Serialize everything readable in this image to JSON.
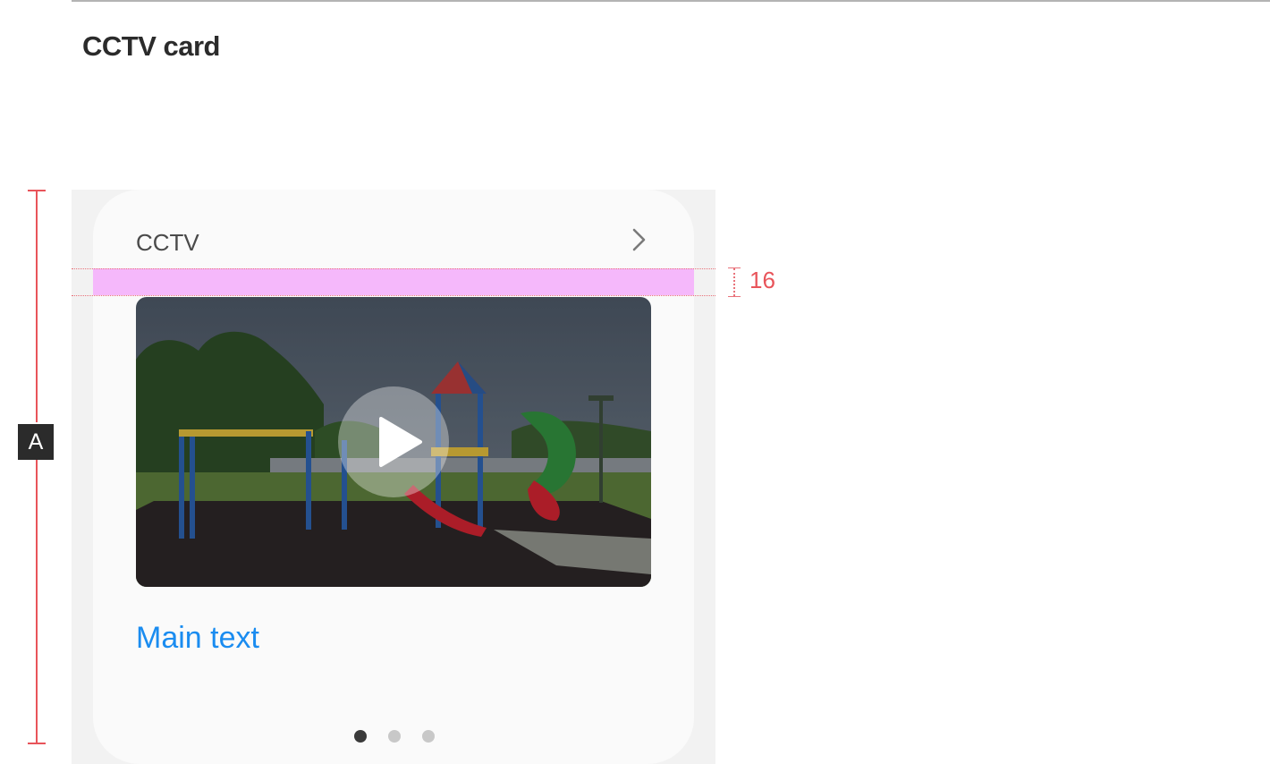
{
  "section": {
    "title": "CCTV card"
  },
  "dimension": {
    "label": "A",
    "spacing_value": "16"
  },
  "card": {
    "title": "CCTV",
    "main_text": "Main text",
    "pagination": {
      "total": 3,
      "active": 1
    }
  },
  "icons": {
    "more": "chevron-right-icon",
    "play": "play-icon"
  },
  "colors": {
    "accent_text": "#1a8cf0",
    "spacer_highlight": "#f5b8fb",
    "dimension_marker": "#e8545a",
    "card_bg": "#fafafa",
    "canvas_bg": "#f2f2f2"
  }
}
